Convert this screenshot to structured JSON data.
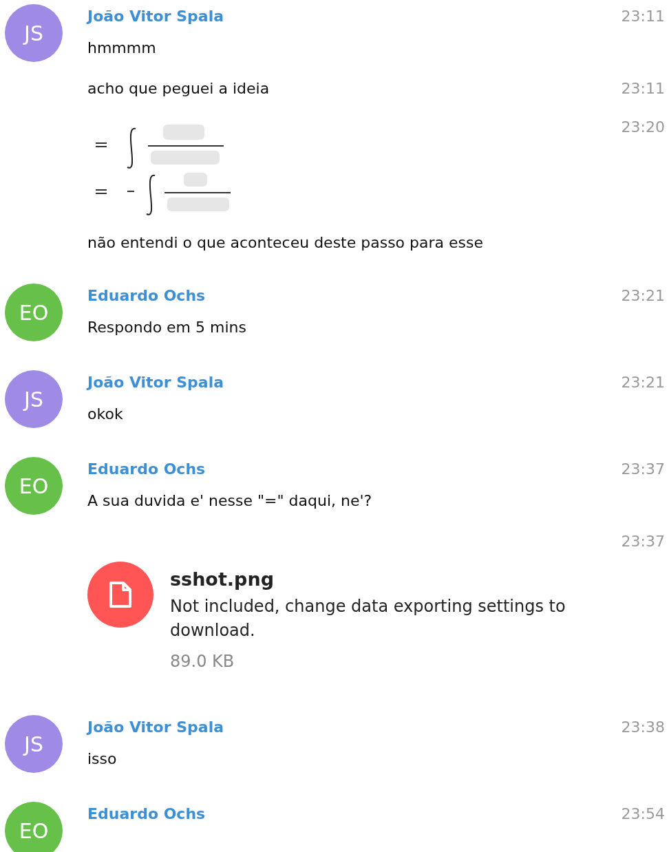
{
  "messages": [
    {
      "kind": "group",
      "avatar": {
        "initials": "JS",
        "color": "#9f8ae6"
      },
      "name": "João Vitor Spala",
      "time": "23:11",
      "text": "hmmmm"
    },
    {
      "kind": "text",
      "time": "23:11",
      "text": "acho que peguei a ideia"
    },
    {
      "time": "23:20",
      "caption": "não entendi o que aconteceu deste passo para esse"
    },
    {
      "kind": "group",
      "avatar": {
        "initials": "EO",
        "color": "#66c04a"
      },
      "name": "Eduardo Ochs",
      "time": "23:21",
      "text": "Respondo em 5 mins"
    },
    {
      "kind": "group",
      "avatar": {
        "initials": "JS",
        "color": "#9f8ae6"
      },
      "name": "João Vitor Spala",
      "time": "23:21",
      "text": "okok"
    },
    {
      "kind": "group",
      "avatar": {
        "initials": "EO",
        "color": "#66c04a"
      },
      "name": "Eduardo Ochs",
      "time": "23:37",
      "text": "A sua duvida e' nesse \"=\" daqui, ne'?"
    },
    {
      "kind": "file",
      "time": "23:37",
      "filename": "sshot.png",
      "description": "Not included, change data exporting settings to download.",
      "size": "89.0 KB"
    },
    {
      "kind": "group",
      "avatar": {
        "initials": "JS",
        "color": "#9f8ae6"
      },
      "name": "João Vitor Spala",
      "time": "23:38",
      "text": "isso"
    },
    {
      "kind": "group_open",
      "avatar": {
        "initials": "EO",
        "color": "#66c04a"
      },
      "name": "Eduardo Ochs",
      "time": "23:54"
    }
  ]
}
